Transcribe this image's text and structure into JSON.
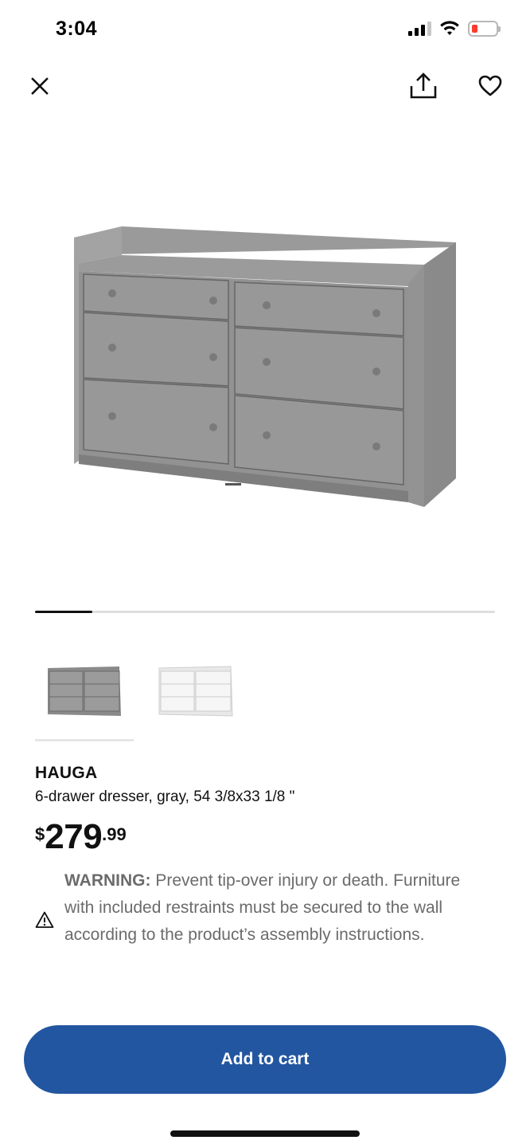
{
  "status_bar": {
    "time": "3:04",
    "icons": [
      "cellular-signal-icon",
      "wifi-icon",
      "battery-low-icon"
    ]
  },
  "nav": {
    "icons": {
      "close": "close-icon",
      "share": "share-icon",
      "favorite": "heart-icon"
    }
  },
  "gallery": {
    "progress": 0.125,
    "thumbnails": [
      {
        "color": "gray",
        "selected": true
      },
      {
        "color": "white",
        "selected": false
      }
    ]
  },
  "product": {
    "name": "HAUGA",
    "description": "6-drawer dresser, gray, 54 3/8x33 1/8 \"",
    "price": {
      "currency": "$",
      "integer": "279",
      "decimal": ".99"
    }
  },
  "warning": {
    "label": "WARNING:",
    "text": " Prevent tip-over injury or death. Furniture with included restraints must be secured to the wall according to the product’s assembly instructions.",
    "icon": "warning-triangle-icon"
  },
  "cta": {
    "label": "Add to cart"
  },
  "colors": {
    "accent": "#2356a0",
    "text": "#111111",
    "muted_text": "#6b6b6b",
    "dresser_gray": "#8f8f8f",
    "battery_low": "#ff3b30"
  }
}
